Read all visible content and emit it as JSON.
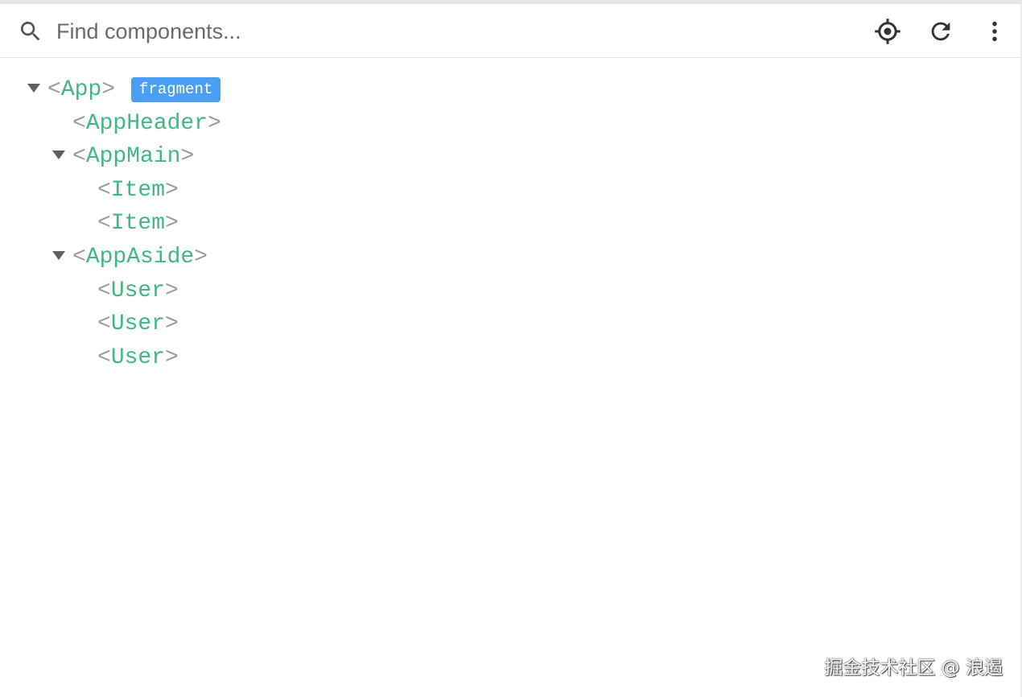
{
  "toolbar": {
    "search": {
      "icon": "search-icon",
      "placeholder": "Find components...",
      "value": ""
    },
    "actions": [
      {
        "icon": "target-select-icon"
      },
      {
        "icon": "refresh-icon"
      },
      {
        "icon": "more-vertical-icon"
      }
    ]
  },
  "colors": {
    "component_name": "#41b883",
    "bracket": "#9a9a9a",
    "badge_bg": "#4a9ff5",
    "arrow": "#5f5f5f"
  },
  "tree": {
    "open_bracket": "<",
    "close_bracket": ">",
    "nodes": [
      {
        "name": "App",
        "expanded": true,
        "badge": "fragment"
      },
      {
        "name": "AppHeader"
      },
      {
        "name": "AppMain",
        "expanded": true
      },
      {
        "name": "Item"
      },
      {
        "name": "Item"
      },
      {
        "name": "AppAside",
        "expanded": true
      },
      {
        "name": "User"
      },
      {
        "name": "User"
      },
      {
        "name": "User"
      }
    ]
  },
  "watermark": "掘金技术社区 @ 浪遏"
}
